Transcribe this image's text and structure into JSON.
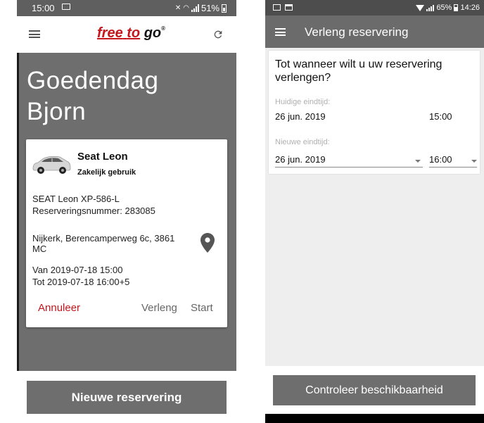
{
  "left_screen": {
    "status_bar": {
      "time": "15:00",
      "battery": "51%"
    },
    "app_bar": {
      "logo_free": "free",
      "logo_to": "to",
      "logo_go": "go",
      "logo_reg": "®"
    },
    "greeting_line1": "Goedendag",
    "greeting_line2": "Bjorn",
    "reservation": {
      "car_name": "Seat Leon",
      "usage": "Zakelijk gebruik",
      "plate": "SEAT Leon XP-586-L",
      "reservation_number": "Reserveringsnummer: 283085",
      "address_line1": "Nijkerk, Berencamperweg 6c, 3861",
      "address_line2": "MC",
      "from": "Van  2019-07-18 15:00",
      "to": "Tot  2019-07-18 16:00+5",
      "cancel_label": "Annuleer",
      "extend_label": "Verleng",
      "start_label": "Start"
    },
    "new_reservation_label": "Nieuwe reservering",
    "colors": {
      "brand_red": "#c4161c",
      "background_gray": "#6e6e6e"
    }
  },
  "right_screen": {
    "status_bar": {
      "battery": "65%",
      "time": "14:26"
    },
    "app_bar": {
      "title": "Verleng reservering"
    },
    "form": {
      "question": "Tot wanneer wilt u uw reservering verlengen?",
      "current_end_label": "Huidige eindtijd:",
      "current_date": "26 jun. 2019",
      "current_time": "15:00",
      "new_end_label": "Nieuwe eindtijd:",
      "new_date": "26 jun. 2019",
      "new_time": "16:00"
    },
    "check_availability_label": "Controleer beschikbaarheid"
  }
}
